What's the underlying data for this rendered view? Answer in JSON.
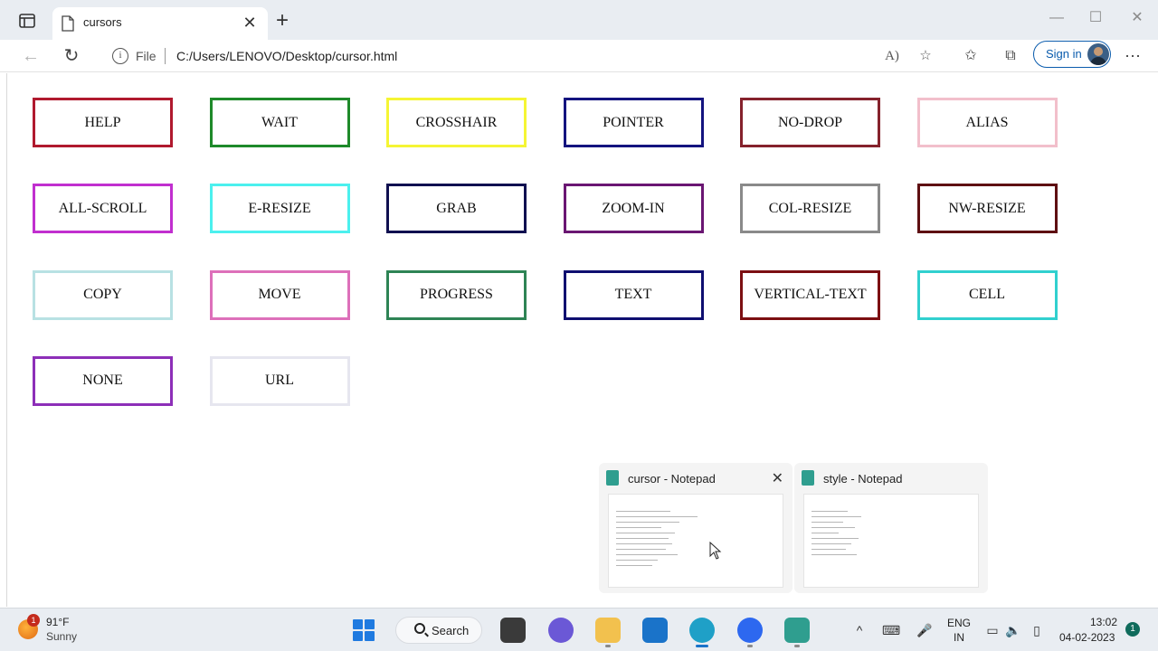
{
  "browser": {
    "tab_title": "cursors",
    "new_tab_symbol": "+",
    "close_symbol": "✕",
    "address": {
      "scheme_label": "File",
      "url": "C:/Users/LENOVO/Desktop/cursor.html"
    },
    "signin_label": "Sign in"
  },
  "page": {
    "boxes": [
      {
        "label": "HELP",
        "border": "#b0192e"
      },
      {
        "label": "WAIT",
        "border": "#1e8a2a"
      },
      {
        "label": "CROSSHAIR",
        "border": "#f5f534"
      },
      {
        "label": "POINTER",
        "border": "#14147f"
      },
      {
        "label": "NO-DROP",
        "border": "#85222c"
      },
      {
        "label": "ALIAS",
        "border": "#f2bfcb"
      },
      {
        "label": "ALL-SCROLL",
        "border": "#c12fcf"
      },
      {
        "label": "E-RESIZE",
        "border": "#4cf0ee"
      },
      {
        "label": "GRAB",
        "border": "#101050"
      },
      {
        "label": "ZOOM-IN",
        "border": "#6a1672"
      },
      {
        "label": "COL-RESIZE",
        "border": "#8a8a8a"
      },
      {
        "label": "NW-RESIZE",
        "border": "#5e0f12"
      },
      {
        "label": "COPY",
        "border": "#b8e1e3"
      },
      {
        "label": "MOVE",
        "border": "#dd70ba"
      },
      {
        "label": "PROGRESS",
        "border": "#2e8455"
      },
      {
        "label": "TEXT",
        "border": "#0e0e70"
      },
      {
        "label": "VERTICAL-TEXT",
        "border": "#7c0f12"
      },
      {
        "label": "CELL",
        "border": "#31d0cf"
      },
      {
        "label": "NONE",
        "border": "#8d2fb8"
      },
      {
        "label": "URL",
        "border": "#e6e6ef"
      }
    ]
  },
  "previews": [
    {
      "title": "cursor - Notepad"
    },
    {
      "title": "style - Notepad"
    }
  ],
  "taskbar": {
    "weather_temp": "91°F",
    "weather_desc": "Sunny",
    "weather_badge": "1",
    "search_label": "Search",
    "lang_line1": "ENG",
    "lang_line2": "IN",
    "time": "13:02",
    "date": "04-02-2023",
    "notification_count": "1"
  }
}
